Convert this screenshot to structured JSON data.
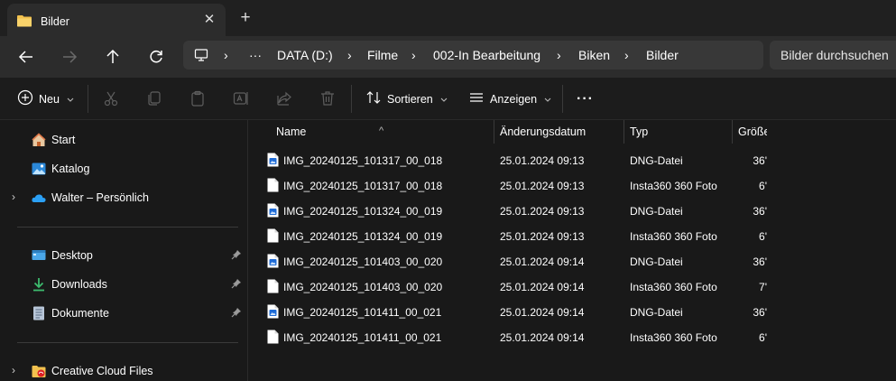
{
  "tab": {
    "title": "Bilder"
  },
  "breadcrumb": [
    "DATA (D:)",
    "Filme",
    "002-In Bearbeitung",
    "Biken",
    "Bilder"
  ],
  "search": {
    "placeholder": "Bilder durchsuchen"
  },
  "toolbar": {
    "new_label": "Neu",
    "sort_label": "Sortieren",
    "view_label": "Anzeigen",
    "more_label": "···"
  },
  "sidebar": {
    "items": [
      {
        "label": "Start",
        "icon": "home-icon"
      },
      {
        "label": "Katalog",
        "icon": "gallery-icon"
      },
      {
        "label": "Walter – Persönlich",
        "icon": "onedrive-cloud-icon"
      },
      {
        "label": "Desktop",
        "icon": "desktop-icon"
      },
      {
        "label": "Downloads",
        "icon": "download-icon"
      },
      {
        "label": "Dokumente",
        "icon": "document-icon"
      },
      {
        "label": "Creative Cloud Files",
        "icon": "creative-cloud-folder-icon"
      }
    ]
  },
  "columns": {
    "name": "Name",
    "date": "Änderungsdatum",
    "type": "Typ",
    "size": "Größe"
  },
  "files": [
    {
      "name": "IMG_20240125_101317_00_018",
      "date": "25.01.2024 09:13",
      "type": "DNG-Datei",
      "size": "36'",
      "kind": "dng"
    },
    {
      "name": "IMG_20240125_101317_00_018",
      "date": "25.01.2024 09:13",
      "type": "Insta360 360 Foto",
      "size": "6'",
      "kind": "plain"
    },
    {
      "name": "IMG_20240125_101324_00_019",
      "date": "25.01.2024 09:13",
      "type": "DNG-Datei",
      "size": "36'",
      "kind": "dng"
    },
    {
      "name": "IMG_20240125_101324_00_019",
      "date": "25.01.2024 09:13",
      "type": "Insta360 360 Foto",
      "size": "6'",
      "kind": "plain"
    },
    {
      "name": "IMG_20240125_101403_00_020",
      "date": "25.01.2024 09:14",
      "type": "DNG-Datei",
      "size": "36'",
      "kind": "dng"
    },
    {
      "name": "IMG_20240125_101403_00_020",
      "date": "25.01.2024 09:14",
      "type": "Insta360 360 Foto",
      "size": "7'",
      "kind": "plain"
    },
    {
      "name": "IMG_20240125_101411_00_021",
      "date": "25.01.2024 09:14",
      "type": "DNG-Datei",
      "size": "36'",
      "kind": "dng"
    },
    {
      "name": "IMG_20240125_101411_00_021",
      "date": "25.01.2024 09:14",
      "type": "Insta360 360 Foto",
      "size": "6'",
      "kind": "plain"
    }
  ],
  "colors": {
    "accent": "#4cc2ff",
    "folder": "#f2c14e",
    "background": "#191919"
  }
}
